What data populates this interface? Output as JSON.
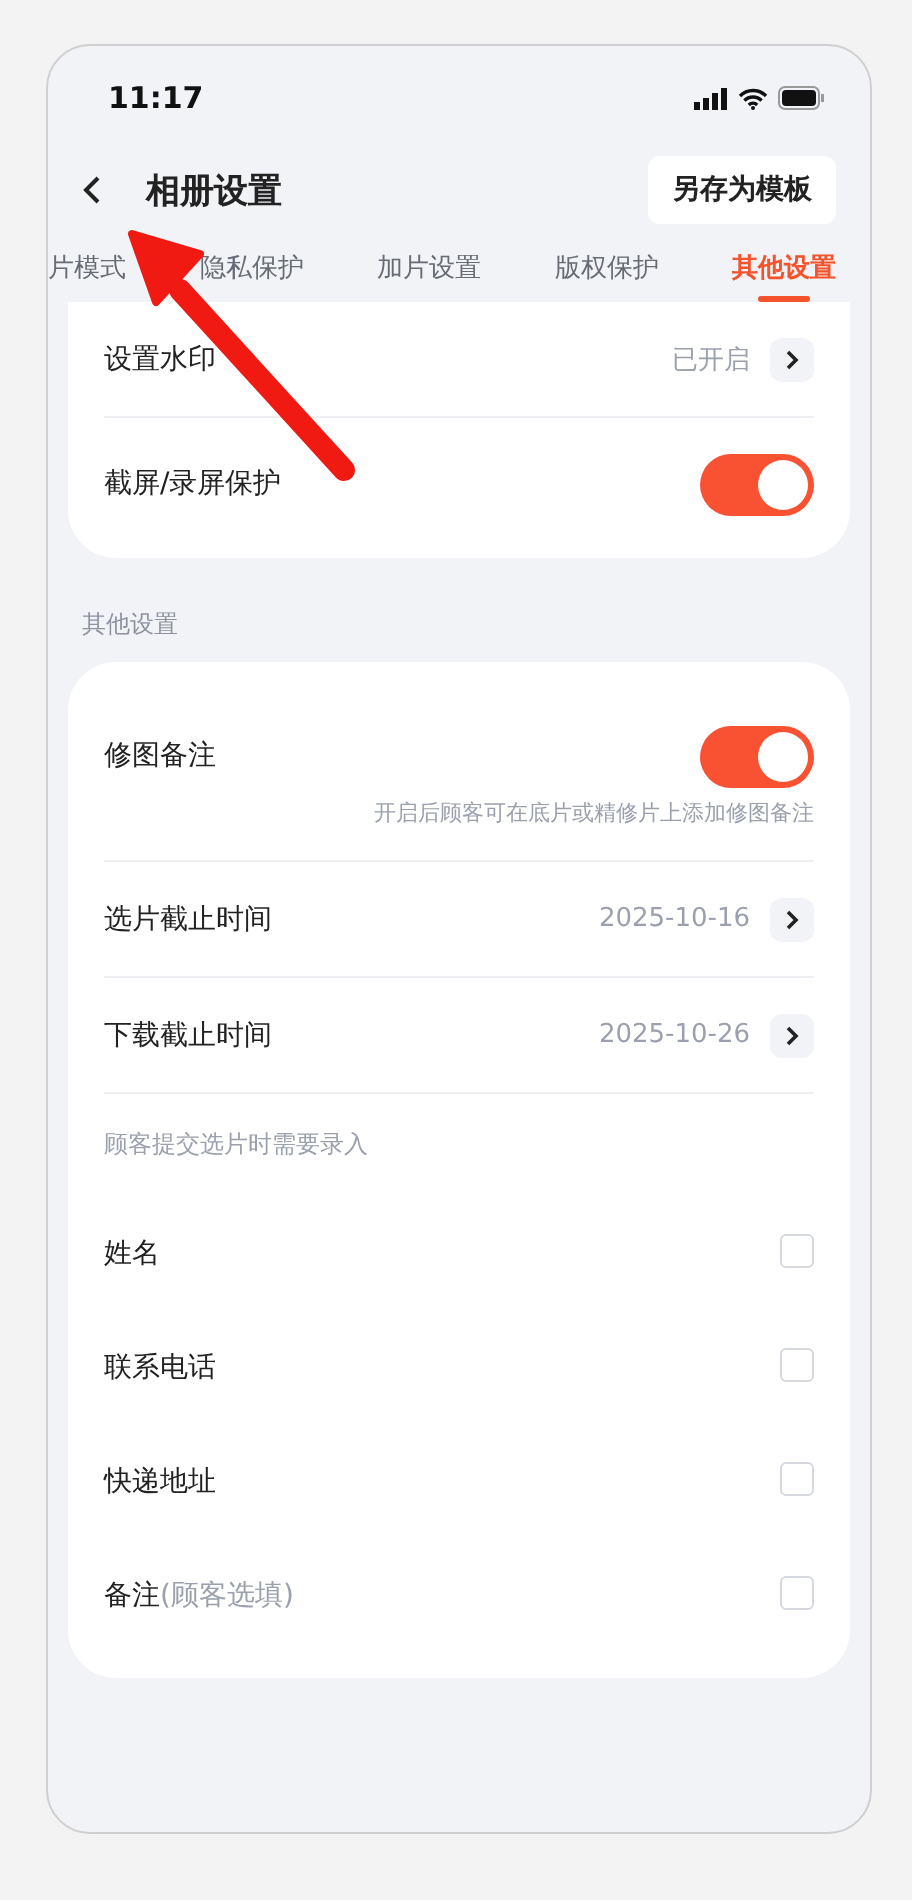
{
  "status_bar": {
    "time": "11:17"
  },
  "header": {
    "title": "相册设置",
    "action": "另存为模板"
  },
  "tabs": [
    {
      "label": "片模式",
      "selected": false
    },
    {
      "label": "隐私保护",
      "selected": false
    },
    {
      "label": "加片设置",
      "selected": false
    },
    {
      "label": "版权保护",
      "selected": false
    },
    {
      "label": "其他设置",
      "selected": true
    }
  ],
  "privacy_card": {
    "rows": [
      {
        "kind": "link",
        "label": "设置水印",
        "value": "已开启"
      },
      {
        "kind": "toggle",
        "label": "截屏/录屏保护",
        "on": true
      }
    ]
  },
  "section_title": "其他设置",
  "other_card": {
    "rows": [
      {
        "kind": "toggle",
        "label": "修图备注",
        "on": true,
        "description": "开启后顾客可在底片或精修片上添加修图备注"
      },
      {
        "kind": "link",
        "label": "选片截止时间",
        "value": "2025-10-16"
      },
      {
        "kind": "link",
        "label": "下载截止时间",
        "value": "2025-10-26"
      },
      {
        "kind": "caption",
        "label": "顾客提交选片时需要录入"
      },
      {
        "kind": "checkbox",
        "label": "姓名",
        "checked": false
      },
      {
        "kind": "checkbox",
        "label": "联系电话",
        "checked": false
      },
      {
        "kind": "checkbox",
        "label": "快递地址",
        "checked": false
      },
      {
        "kind": "checkbox",
        "label": "备注",
        "hint": "(顾客选填)",
        "checked": false
      }
    ]
  }
}
